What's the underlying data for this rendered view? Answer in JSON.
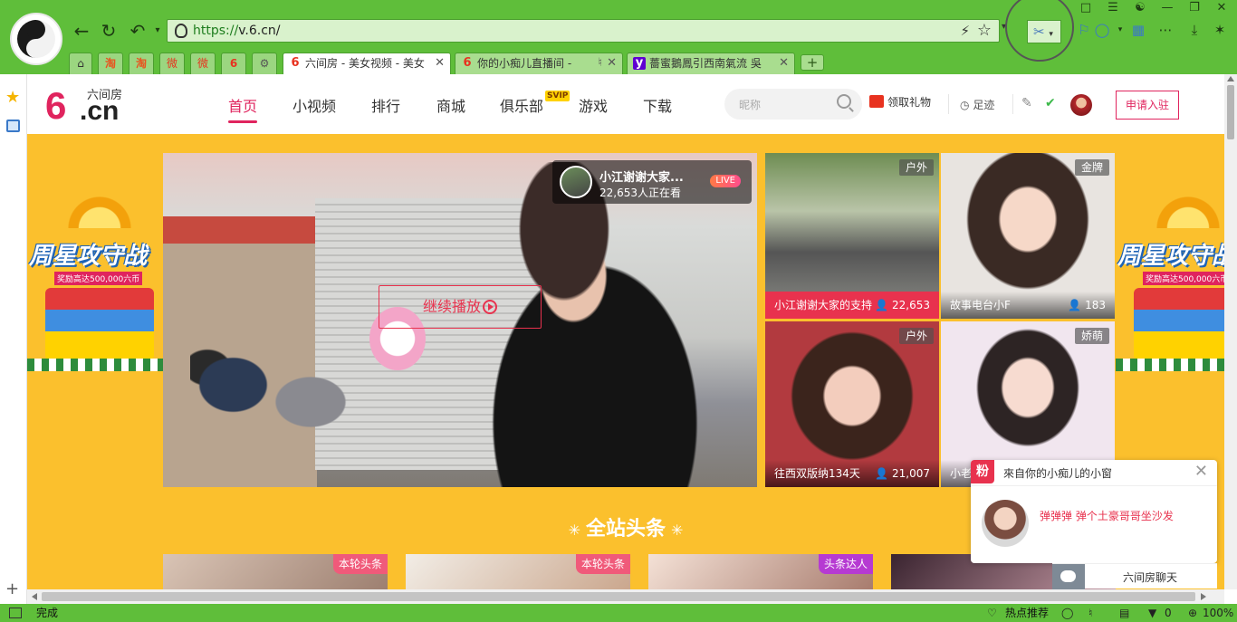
{
  "browser": {
    "url_scheme": "https://",
    "url_rest": "v.6.cn/",
    "tabs": [
      {
        "favicon": "6",
        "label": "六间房 - 美女视频 - 美女",
        "active": true
      },
      {
        "favicon": "6",
        "label": "你的小痴儿直播间 -",
        "active": false
      },
      {
        "favicon": "y",
        "label": "薔蜜鵝鳳引西南氣流 吳",
        "active": false
      }
    ],
    "mini_tabs": [
      "淘",
      "淘",
      "微",
      "微",
      "6"
    ],
    "status_text": "完成",
    "hot_label": "热点推荐",
    "download_count": "0",
    "zoom": "100%"
  },
  "header": {
    "logo_six": "6",
    "logo_cn": ".cn",
    "logo_name": "六间房",
    "nav": [
      "首页",
      "小视频",
      "排行",
      "商城",
      "俱乐部",
      "游戏",
      "下载"
    ],
    "svip": "SVIP",
    "search_placeholder": "昵称",
    "gift": "领取礼物",
    "footprint": "足迹",
    "apply": "申请入驻"
  },
  "player": {
    "resume": "继续播放",
    "name": "小江谢谢大家...",
    "viewers": "22,653人正在看",
    "live": "LIVE"
  },
  "thumbs": [
    {
      "tag": "户外",
      "caption": "小江谢谢大家的支持",
      "views": "22,653"
    },
    {
      "tag": "金牌",
      "caption": "故事电台小F",
      "views": "183"
    },
    {
      "tag": "户外",
      "caption": "往西双版纳134天",
      "views": "21,007"
    },
    {
      "tag": "娇萌",
      "caption": "小老",
      "views": ""
    }
  ],
  "ad": {
    "title": "周星攻守战",
    "sub": "奖励高达500,000六币"
  },
  "headline": "全站头条",
  "headline_cards": [
    "本轮头条",
    "本轮头条",
    "头条达人",
    ""
  ],
  "popup": {
    "badge": "粉",
    "title": "來自你的小痴儿的小窗",
    "message": "弹弹弹 弹个土豪哥哥坐沙发"
  },
  "chat": {
    "label": "六间房聊天"
  },
  "colors": {
    "brand": "#e0245e",
    "browser_green": "#5fbe3a",
    "page_bg": "#fbc02d"
  }
}
